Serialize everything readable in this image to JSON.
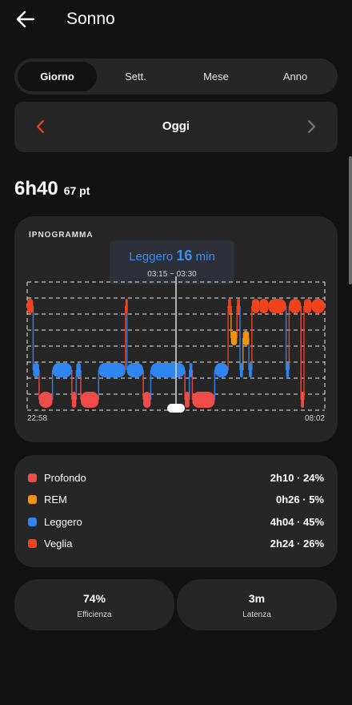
{
  "header": {
    "title": "Sonno",
    "back_icon": "arrow-left-icon"
  },
  "tabs": [
    {
      "label": "Giorno",
      "active": true
    },
    {
      "label": "Sett.",
      "active": false
    },
    {
      "label": "Mese",
      "active": false
    },
    {
      "label": "Anno",
      "active": false
    }
  ],
  "date_nav": {
    "label": "Oggi",
    "prev_icon": "chevron-left-icon",
    "next_icon": "chevron-right-icon",
    "prev_color": "#e8452c",
    "next_color": "#777777"
  },
  "summary": {
    "duration": "6h40",
    "score": "67 pt"
  },
  "hypnogram": {
    "title": "IPNOGRAMMA",
    "tooltip": {
      "stage": "Leggero",
      "minutes": "16",
      "unit": "min",
      "range": "03:15 ~ 03:30"
    },
    "start_time": "22:58",
    "end_time": "08:02"
  },
  "chart_data": {
    "type": "hypnogram",
    "x_start": "22:58",
    "x_end": "08:02",
    "stages": [
      "Veglia",
      "REM",
      "Leggero",
      "Profondo"
    ],
    "selected_range": "03:15 ~ 03:30",
    "segments": [
      {
        "stage": "Veglia",
        "start": 0.0,
        "end": 0.02
      },
      {
        "stage": "Leggero",
        "start": 0.02,
        "end": 0.04
      },
      {
        "stage": "Profondo",
        "start": 0.04,
        "end": 0.085
      },
      {
        "stage": "Leggero",
        "start": 0.085,
        "end": 0.15
      },
      {
        "stage": "Profondo",
        "start": 0.15,
        "end": 0.165
      },
      {
        "stage": "Leggero",
        "start": 0.165,
        "end": 0.18
      },
      {
        "stage": "Profondo",
        "start": 0.18,
        "end": 0.24
      },
      {
        "stage": "Leggero",
        "start": 0.24,
        "end": 0.33
      },
      {
        "stage": "Veglia",
        "start": 0.33,
        "end": 0.335
      },
      {
        "stage": "Leggero",
        "start": 0.335,
        "end": 0.39
      },
      {
        "stage": "Profondo",
        "start": 0.39,
        "end": 0.415
      },
      {
        "stage": "Leggero",
        "start": 0.415,
        "end": 0.53
      },
      {
        "stage": "Profondo",
        "start": 0.53,
        "end": 0.545
      },
      {
        "stage": "Leggero",
        "start": 0.545,
        "end": 0.555
      },
      {
        "stage": "Profondo",
        "start": 0.555,
        "end": 0.63
      },
      {
        "stage": "Leggero",
        "start": 0.63,
        "end": 0.675
      },
      {
        "stage": "Veglia",
        "start": 0.675,
        "end": 0.685
      },
      {
        "stage": "REM",
        "start": 0.685,
        "end": 0.705
      },
      {
        "stage": "Veglia",
        "start": 0.705,
        "end": 0.715
      },
      {
        "stage": "Leggero",
        "start": 0.715,
        "end": 0.725
      },
      {
        "stage": "REM",
        "start": 0.725,
        "end": 0.745
      },
      {
        "stage": "Leggero",
        "start": 0.745,
        "end": 0.755
      },
      {
        "stage": "Veglia",
        "start": 0.755,
        "end": 0.78
      },
      {
        "stage": "Veglia",
        "start": 0.78,
        "end": 0.81
      },
      {
        "stage": "Veglia",
        "start": 0.81,
        "end": 0.87
      },
      {
        "stage": "Leggero",
        "start": 0.87,
        "end": 0.88
      },
      {
        "stage": "Veglia",
        "start": 0.88,
        "end": 0.92
      },
      {
        "stage": "Profondo",
        "start": 0.92,
        "end": 0.93
      },
      {
        "stage": "Veglia",
        "start": 0.93,
        "end": 0.955
      },
      {
        "stage": "Veglia",
        "start": 0.955,
        "end": 1.0
      }
    ]
  },
  "legend": [
    {
      "label": "Profondo",
      "value": "2h10 · 24%",
      "color": "#ef4b47"
    },
    {
      "label": "REM",
      "value": "0h26 · 5%",
      "color": "#f2930d"
    },
    {
      "label": "Leggero",
      "value": "4h04 · 45%",
      "color": "#2f86f0"
    },
    {
      "label": "Veglia",
      "value": "2h24 · 26%",
      "color": "#f0431c"
    }
  ],
  "stats": [
    {
      "value": "74%",
      "label": "Efficienza"
    },
    {
      "value": "3m",
      "label": "Latenza"
    }
  ]
}
